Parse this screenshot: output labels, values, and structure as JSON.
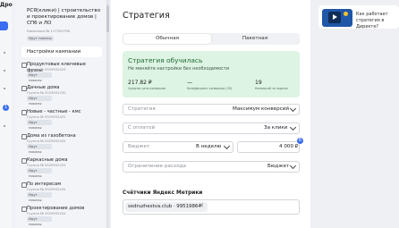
{
  "app": {
    "logo_text": "Дро"
  },
  "nav": {
    "notifications_count": "1"
  },
  "campaign": {
    "title": "РСЯ(клики) | строительство и проектирование домов | СПб и ЛО",
    "number": "Кампания № 117305796",
    "status_badge": "Идут показы"
  },
  "sidebar": {
    "settings_label": "Настройки кампании",
    "groups": [
      {
        "name": "Продуктовые ключевые фразы",
        "number": "Группа № 5529932429",
        "badge": "Идут показы"
      },
      {
        "name": "Дачные дома",
        "number": "Группа № 5529932430",
        "badge": "Идут показы"
      },
      {
        "name": "Новые - частные - кмс",
        "number": "Группа № 5529932431",
        "badge": "Идут показы"
      },
      {
        "name": "Дома из газобетона",
        "number": "Группа № 5529932432",
        "badge": "Идут показы"
      },
      {
        "name": "Каркасные дома",
        "number": "Группа № 5529932433",
        "badge": "Идут показы"
      },
      {
        "name": "По интересам",
        "number": "Группа № 5529932435",
        "badge": "Идут показы"
      },
      {
        "name": "Проектирование домов",
        "number": "Группа № 5529932434",
        "badge": "Идут показы"
      }
    ]
  },
  "strategy": {
    "title": "Стратегия",
    "tabs": [
      "Обычная",
      "Пакетная"
    ],
    "active_tab": "Обычная",
    "learned_title": "Стратегия обучилась",
    "learned_subtitle": "Не меняйте настройки без необходимости",
    "stats": [
      {
        "value": "217.82 ₽",
        "caption": "Средняя цена конверсии"
      },
      {
        "value": "—",
        "caption": "Коэффициент конверсии (CR)"
      },
      {
        "value": "19",
        "caption": "Конверсий за неделю"
      }
    ],
    "strategy_field": {
      "label": "Стратегия",
      "value": "Максимум конверсий"
    },
    "payment_field": {
      "label": "С оплатой",
      "value": "За клики"
    },
    "budget_field": {
      "label": "Бюджет",
      "period": "В неделю",
      "amount": "4 000 ₽"
    },
    "budget_info_badge": "6",
    "limit_field": {
      "label": "Ограничение расхода",
      "value": "Бюджет"
    },
    "metrika_title": "Счётчики Яндекс Метрики",
    "metrika_tag": "sodruzhestva.club · 99519864"
  },
  "promo": {
    "text": "Как работает стратегия в Директе?"
  },
  "colors": {
    "accent": "#3a6df0",
    "success_bg": "#ddf3e3",
    "success_text": "#1e6b33"
  }
}
